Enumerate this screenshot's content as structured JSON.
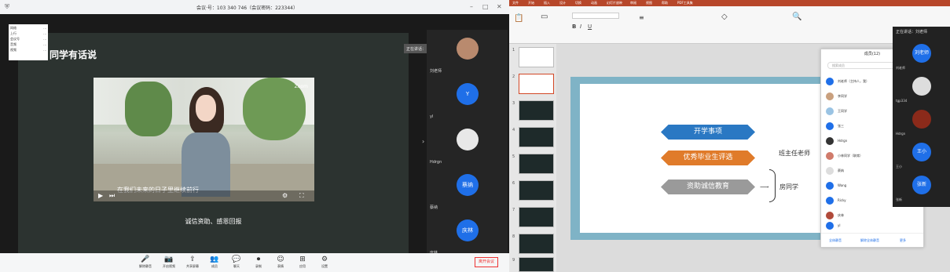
{
  "meeting": {
    "title": "会议·号：103 340 746（会议密码：223344）",
    "stats": [
      {
        "k": "网络",
        "v": "..."
      },
      {
        "k": "上行",
        "v": "..."
      },
      {
        "k": "会议号",
        "v": "..."
      },
      {
        "k": "音频",
        "v": "..."
      },
      {
        "k": "视频",
        "v": "..."
      }
    ],
    "share_title": "同学有话说",
    "video_subtitle": "在我们未来的日子里继续前行",
    "video_logo": "Zoom",
    "caption": "诚信资助、感恩回报",
    "speaking_label": "正在讲话：",
    "participants": [
      {
        "name": "刘老师",
        "avatar": ""
      },
      {
        "name": "yl",
        "avatar": "Y"
      },
      {
        "name": "Hdrgn",
        "avatar": ""
      },
      {
        "name": "蔡纳",
        "avatar": "蔡纳"
      },
      {
        "name": "庆林",
        "avatar": "庆林"
      }
    ],
    "toolbar": [
      {
        "icon": "🎤",
        "label": "解除静音"
      },
      {
        "icon": "📷",
        "label": "开启视频"
      },
      {
        "icon": "⇪",
        "label": "共享屏幕"
      },
      {
        "icon": "👥",
        "label": "成员"
      },
      {
        "icon": "💬",
        "label": "聊天"
      },
      {
        "icon": "⏺",
        "label": "录制"
      },
      {
        "icon": "☺",
        "label": "表情"
      },
      {
        "icon": "⊞",
        "label": "应用"
      },
      {
        "icon": "⚙",
        "label": "设置"
      }
    ],
    "leave_label": "离开会议"
  },
  "ppt": {
    "tabs": [
      "文件",
      "开始",
      "插入",
      "设计",
      "切换",
      "动画",
      "幻灯片放映",
      "审阅",
      "视图",
      "帮助",
      "PDF工具集"
    ],
    "slide_count": 9,
    "arrows": [
      {
        "text": "开学事项",
        "color": "#2a78c3"
      },
      {
        "text": "优秀毕业生评选",
        "color": "#e07b2a"
      },
      {
        "text": "资助诚信教育",
        "color": "#9a9a9a"
      }
    ],
    "handwritten": [
      "班主任老师",
      "房同学"
    ],
    "chat": {
      "header": "成员(12)",
      "search_placeholder": "搜索成员",
      "members": [
        "刘老师（主持人，我）",
        "李同学",
        "王同学",
        "张三",
        "Hdrgn",
        "小林同学（联席）",
        "蔡纳",
        "Wang",
        "Ricky",
        "庆林",
        "yl"
      ],
      "footer": [
        "全体静音",
        "解除全体静音",
        "更多"
      ]
    },
    "float": {
      "header": "正在讲话：刘老师",
      "avatars": [
        "刘老师",
        "",
        "",
        "王小",
        "张新"
      ],
      "names": [
        "刘老师",
        "tgp334",
        "Hdrgn",
        "王小",
        "张新"
      ]
    }
  }
}
